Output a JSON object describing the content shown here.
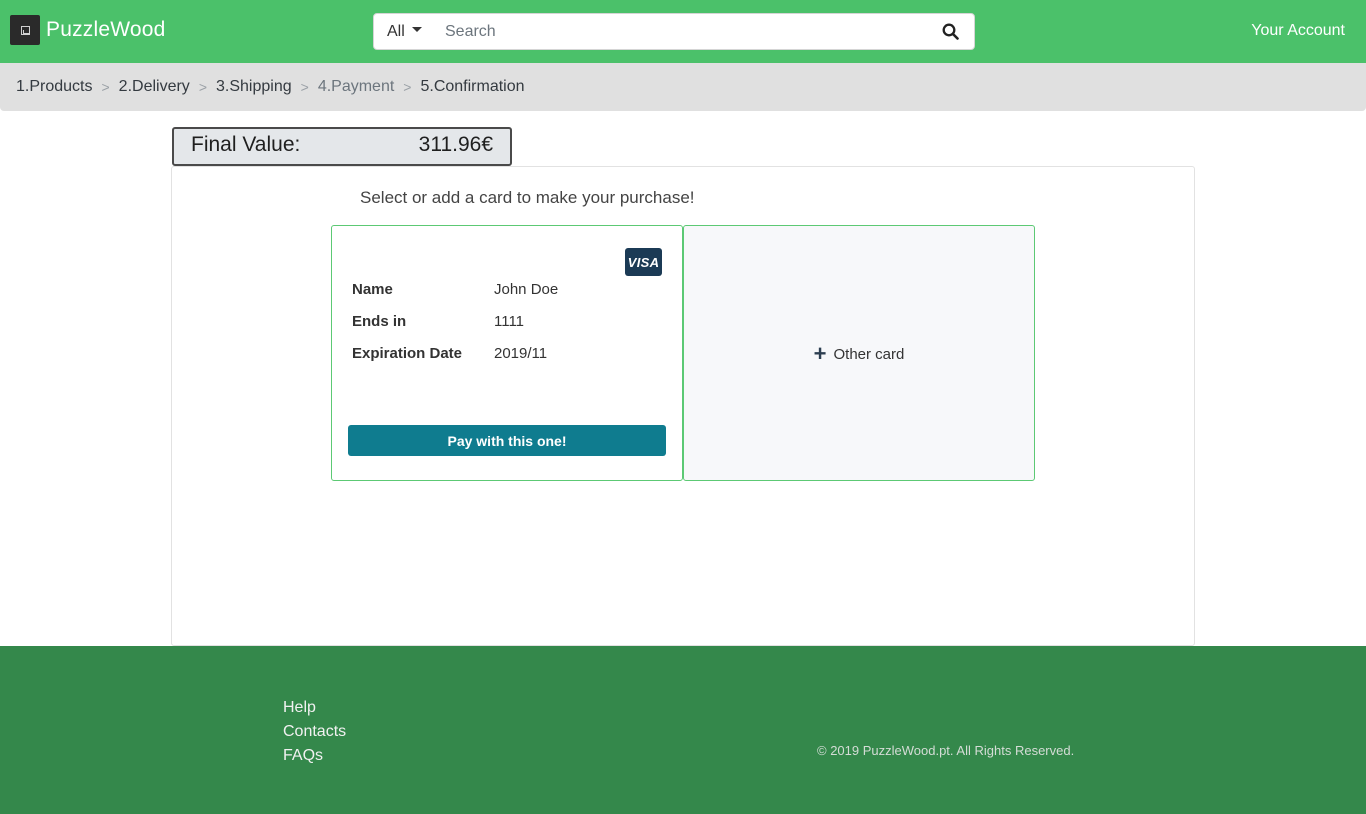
{
  "navbar": {
    "brand": "PuzzleWood",
    "search_category": "All",
    "search_placeholder": "Search",
    "account_label": "Your Account"
  },
  "breadcrumb": [
    {
      "label": "1.Products",
      "active": true
    },
    {
      "label": "2.Delivery",
      "active": true
    },
    {
      "label": "3.Shipping",
      "active": true
    },
    {
      "label": "4.Payment",
      "active": false
    },
    {
      "label": "5.Confirmation",
      "active": true
    }
  ],
  "breadcrumb_separator": ">",
  "summary": {
    "label": "Final Value:",
    "value": "311.96€"
  },
  "payment": {
    "prompt": "Select or add a card to make your purchase!",
    "card": {
      "brand": "VISA",
      "fields": [
        {
          "key": "Name",
          "value": "John Doe"
        },
        {
          "key": "Ends in",
          "value": "1111"
        },
        {
          "key": "Expiration Date",
          "value": "2019/11"
        }
      ],
      "pay_label": "Pay with this one!"
    },
    "other_card": {
      "icon": "+",
      "label": "Other card"
    }
  },
  "footer": {
    "links": [
      "Help",
      "Contacts",
      "FAQs"
    ],
    "copyright": "© 2019 PuzzleWood.pt. All Rights Reserved."
  },
  "colors": {
    "navbar": "#4bc16a",
    "footer": "#34884b",
    "pay_button": "#0f7c8f",
    "card_border": "#5cc974"
  }
}
